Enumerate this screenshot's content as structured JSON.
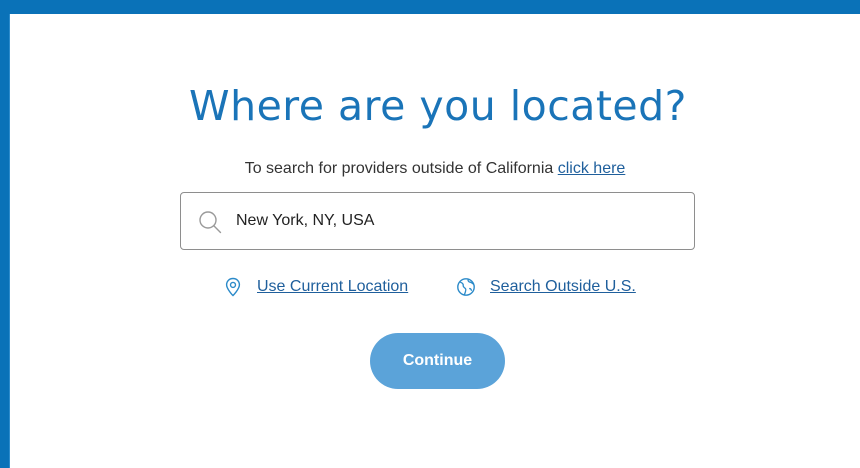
{
  "page": {
    "title": "Where are you located?",
    "subtitle_text": "To search for providers outside of California ",
    "subtitle_link": "click here"
  },
  "search": {
    "value": "New York, NY, USA",
    "icon": "search-icon"
  },
  "links": {
    "current_location": "Use Current Location",
    "current_location_icon": "location-pin-icon",
    "search_outside": "Search Outside U.S.",
    "search_outside_icon": "globe-icon"
  },
  "actions": {
    "continue_label": "Continue"
  },
  "colors": {
    "brand_blue": "#0a72b8",
    "title_blue": "#1a74b8",
    "link_blue": "#1f5f9c",
    "button_blue": "#5ba3d9"
  }
}
